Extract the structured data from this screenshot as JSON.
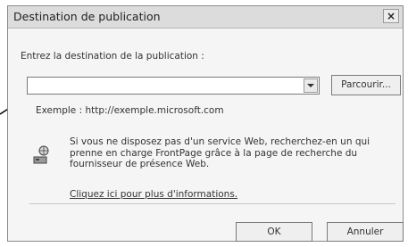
{
  "window": {
    "title": "Destination de publication",
    "close_glyph": "×"
  },
  "destination": {
    "label": "Entrez la destination de la publication :",
    "value": "",
    "placeholder": "",
    "browse_label": "Parcourir..."
  },
  "example_text": "Exemple : http://exemple.microsoft.com",
  "info": {
    "icon": "web-server-icon",
    "text": "Si vous ne disposez pas d'un service Web, recherchez-en un qui prenne en charge FrontPage grâce à la page de recherche du fournisseur de présence Web.",
    "link": "Cliquez ici pour plus d'informations."
  },
  "buttons": {
    "ok": "OK",
    "cancel": "Annuler"
  }
}
